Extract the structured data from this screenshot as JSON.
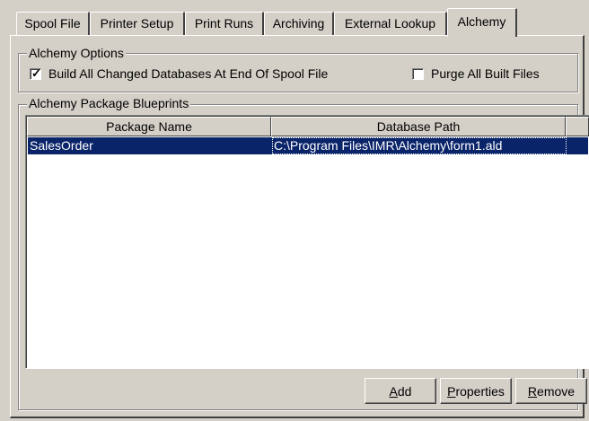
{
  "tabs": [
    {
      "label": "Spool File"
    },
    {
      "label": "Printer Setup"
    },
    {
      "label": "Print Runs"
    },
    {
      "label": "Archiving"
    },
    {
      "label": "External Lookup"
    },
    {
      "label": "Alchemy",
      "active": true
    }
  ],
  "alchemy_options": {
    "title": "Alchemy Options",
    "build_all": {
      "label": "Build All Changed Databases At End Of Spool File",
      "checked": true
    },
    "purge_all": {
      "label": "Purge All Built Files",
      "checked": false
    }
  },
  "blueprints": {
    "title": "Alchemy Package Blueprints",
    "columns": [
      "Package Name",
      "Database Path"
    ],
    "rows": [
      {
        "package_name": "SalesOrder",
        "database_path": "C:\\Program Files\\IMR\\Alchemy\\form1.ald",
        "selected": true
      }
    ]
  },
  "buttons": {
    "add": {
      "mnemonic": "A",
      "rest": "dd"
    },
    "properties": {
      "mnemonic": "P",
      "rest": "roperties"
    },
    "remove": {
      "mnemonic": "R",
      "rest": "emove"
    }
  },
  "colors": {
    "window_bg": "#d4d0c8",
    "selection": "#0a246a"
  }
}
